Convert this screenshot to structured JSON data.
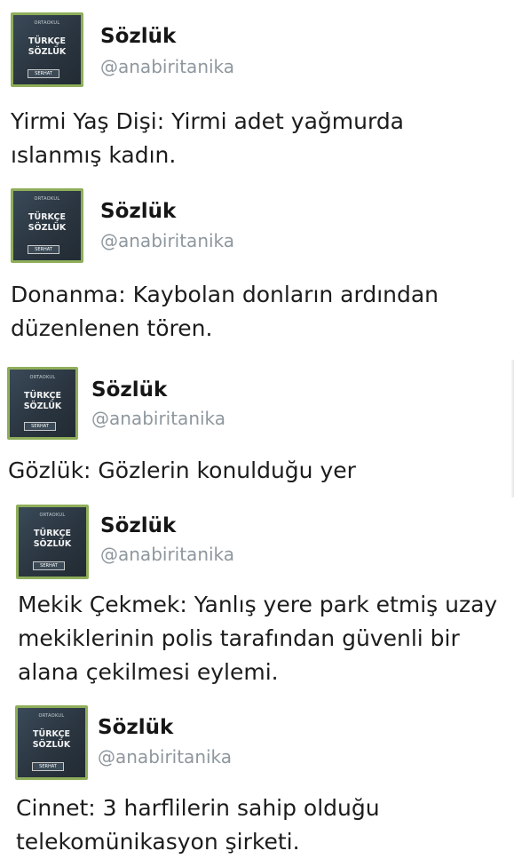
{
  "avatar": {
    "top_label": "ORTAOKUL",
    "title_line1": "TÜRKÇE",
    "title_line2": "SÖZLÜK",
    "badge": "SERHAT"
  },
  "tweets": [
    {
      "name": "Sözlük",
      "handle": "@anabiritanika",
      "text_lines": [
        "Yirmi Yaş Dişi: Yirmi adet yağmurda",
        "ıslanmış kadın."
      ]
    },
    {
      "name": "Sözlük",
      "handle": "@anabiritanika",
      "text_lines": [
        "Donanma: Kaybolan donların ardından",
        "düzenlenen tören."
      ]
    },
    {
      "name": "Sözlük",
      "handle": "@anabiritanika",
      "text_lines": [
        "Gözlük: Gözlerin konulduğu yer"
      ]
    },
    {
      "name": "Sözlük",
      "handle": "@anabiritanika",
      "text_lines": [
        "Mekik Çekmek: Yanlış yere park etmiş uzay",
        "mekiklerinin polis tarafından güvenli bir",
        "alana çekilmesi eylemi."
      ]
    },
    {
      "name": "Sözlük",
      "handle": "@anabiritanika",
      "text_lines": [
        "Cinnet: 3 harflilerin sahip olduğu",
        "telekomünikasyon şirketi."
      ]
    }
  ]
}
